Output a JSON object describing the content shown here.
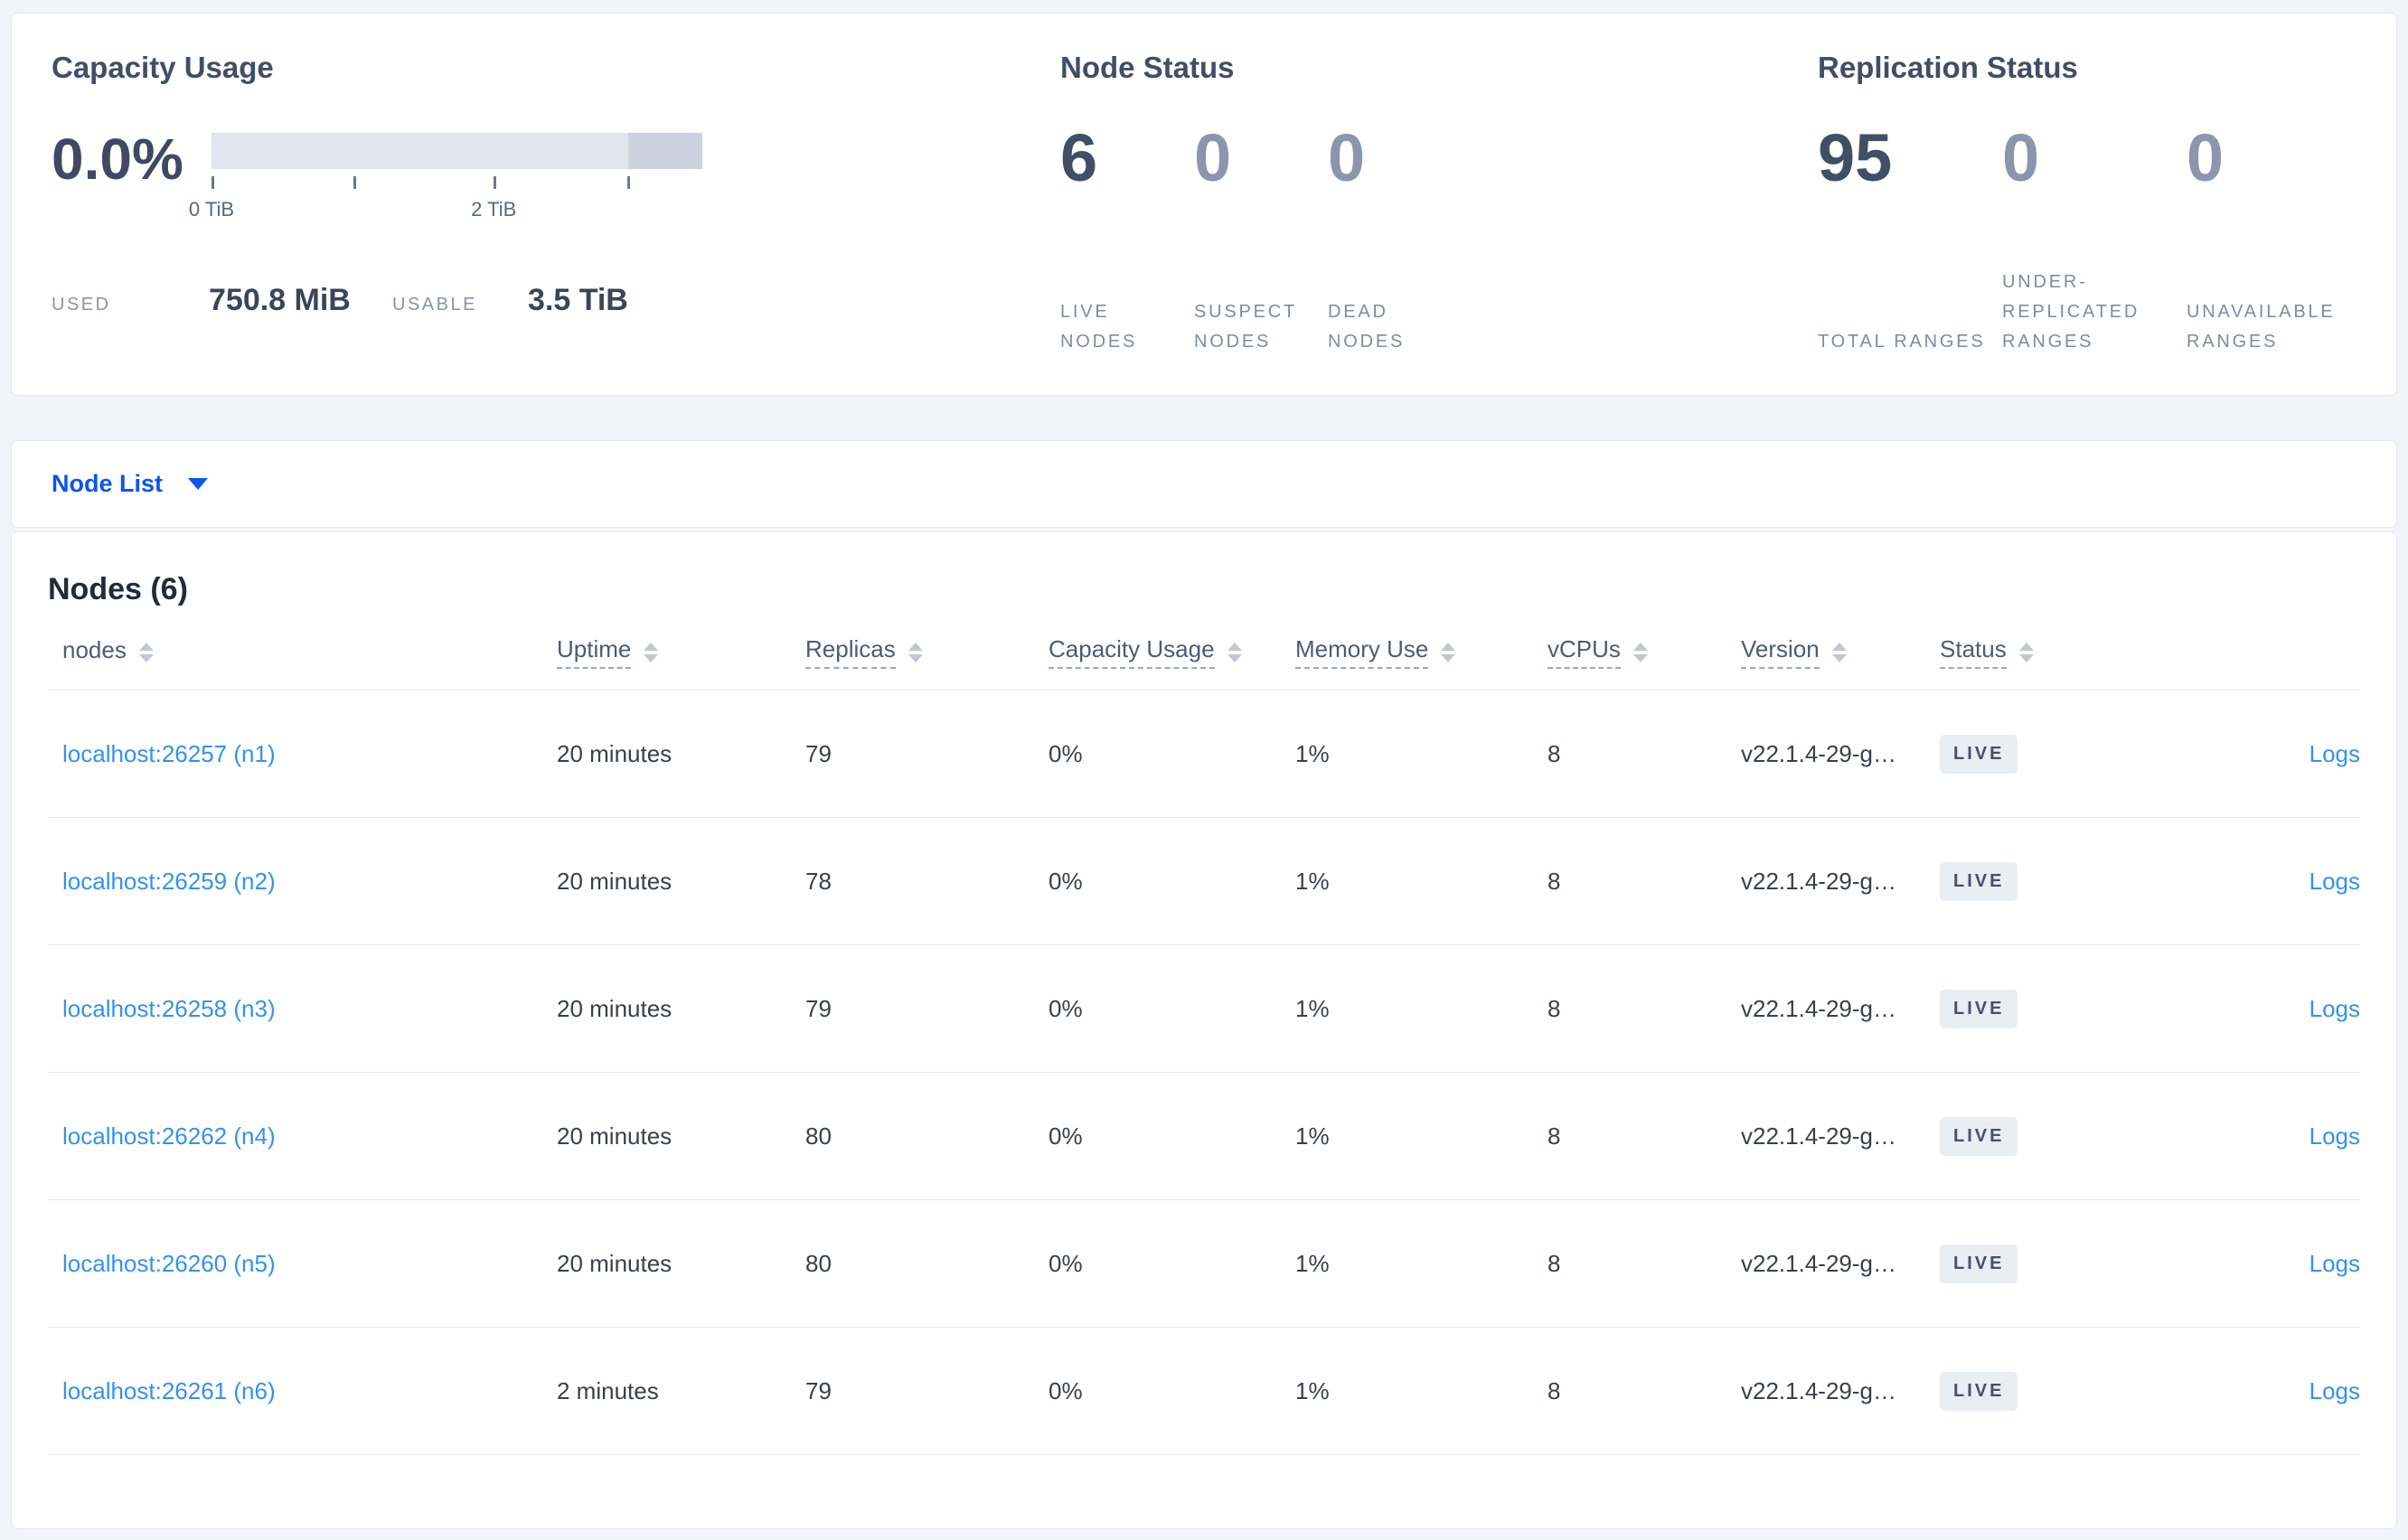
{
  "summary": {
    "capacity": {
      "title": "Capacity Usage",
      "percent": "0.0%",
      "tick_labels": [
        "0 TiB",
        "2 TiB"
      ],
      "used_label": "USED",
      "used_value": "750.8 MiB",
      "usable_label": "USABLE",
      "usable_value": "3.5 TiB"
    },
    "node_status": {
      "title": "Node Status",
      "stats": [
        {
          "value": "6",
          "label": "LIVE NODES"
        },
        {
          "value": "0",
          "label": "SUSPECT NODES"
        },
        {
          "value": "0",
          "label": "DEAD NODES"
        }
      ]
    },
    "replication": {
      "title": "Replication Status",
      "stats": [
        {
          "value": "95",
          "label": "TOTAL RANGES"
        },
        {
          "value": "0",
          "label": "UNDER-REPLICATED RANGES"
        },
        {
          "value": "0",
          "label": "UNAVAILABLE RANGES"
        }
      ]
    }
  },
  "node_list": {
    "dropdown_label": "Node List"
  },
  "nodes_section": {
    "title": "Nodes (6)",
    "columns": [
      "nodes",
      "Uptime",
      "Replicas",
      "Capacity Usage",
      "Memory Use",
      "vCPUs",
      "Version",
      "Status"
    ],
    "rows": [
      {
        "node": "localhost:26257 (n1)",
        "uptime": "20 minutes",
        "replicas": "79",
        "capacity": "0%",
        "memory": "1%",
        "vcpus": "8",
        "version": "v22.1.4-29-g…",
        "status": "LIVE",
        "logs": "Logs"
      },
      {
        "node": "localhost:26259 (n2)",
        "uptime": "20 minutes",
        "replicas": "78",
        "capacity": "0%",
        "memory": "1%",
        "vcpus": "8",
        "version": "v22.1.4-29-g…",
        "status": "LIVE",
        "logs": "Logs"
      },
      {
        "node": "localhost:26258 (n3)",
        "uptime": "20 minutes",
        "replicas": "79",
        "capacity": "0%",
        "memory": "1%",
        "vcpus": "8",
        "version": "v22.1.4-29-g…",
        "status": "LIVE",
        "logs": "Logs"
      },
      {
        "node": "localhost:26262 (n4)",
        "uptime": "20 minutes",
        "replicas": "80",
        "capacity": "0%",
        "memory": "1%",
        "vcpus": "8",
        "version": "v22.1.4-29-g…",
        "status": "LIVE",
        "logs": "Logs"
      },
      {
        "node": "localhost:26260 (n5)",
        "uptime": "20 minutes",
        "replicas": "80",
        "capacity": "0%",
        "memory": "1%",
        "vcpus": "8",
        "version": "v22.1.4-29-g…",
        "status": "LIVE",
        "logs": "Logs"
      },
      {
        "node": "localhost:26261 (n6)",
        "uptime": "2 minutes",
        "replicas": "79",
        "capacity": "0%",
        "memory": "1%",
        "vcpus": "8",
        "version": "v22.1.4-29-g…",
        "status": "LIVE",
        "logs": "Logs"
      }
    ]
  },
  "colors": {
    "accent_blue": "#0c56f0",
    "link_blue": "#3292f2",
    "stat_dark": "#404e66",
    "stat_muted": "#8b95ad",
    "bar_light": "#e2e4ee",
    "bar_dark": "#cdd0de",
    "badge_bg": "#e9edf4",
    "page_bg": "#f2f4f9"
  }
}
